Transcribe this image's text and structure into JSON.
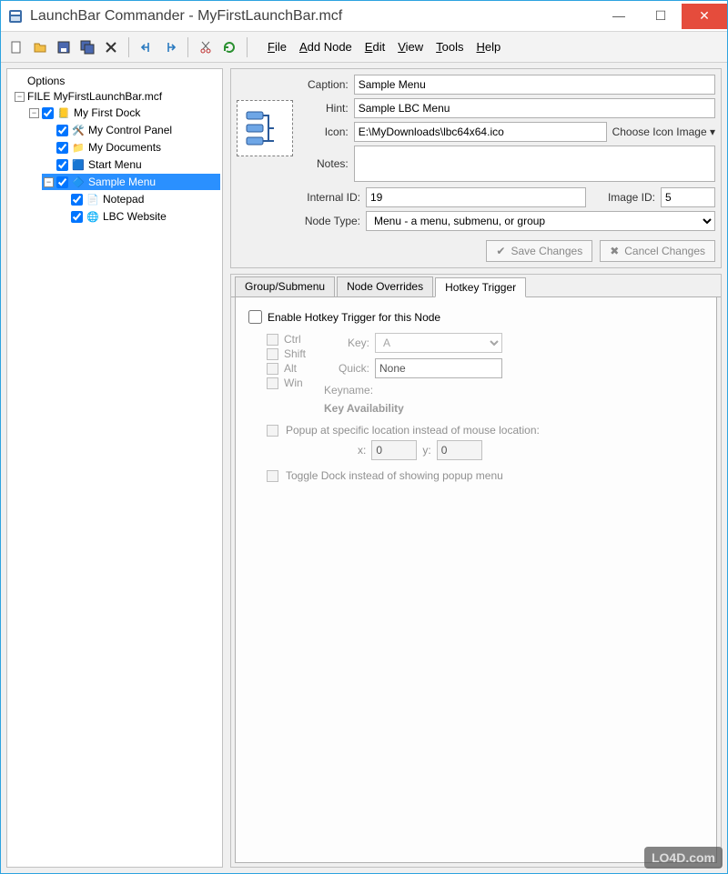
{
  "window": {
    "title": "LaunchBar Commander - MyFirstLaunchBar.mcf"
  },
  "menubar": {
    "file": "File",
    "addnode": "Add Node",
    "edit": "Edit",
    "view": "View",
    "tools": "Tools",
    "help": "Help"
  },
  "tree": {
    "options": "Options",
    "file_node": "FILE MyFirstLaunchBar.mcf",
    "dock": "My First Dock",
    "items": {
      "mcp": "My Control Panel",
      "mydocs": "My Documents",
      "startmenu": "Start Menu",
      "samplemenu": "Sample Menu",
      "notepad": "Notepad",
      "lbcweb": "LBC Website"
    }
  },
  "props": {
    "labels": {
      "caption": "Caption:",
      "hint": "Hint:",
      "icon": "Icon:",
      "notes": "Notes:",
      "internalid": "Internal ID:",
      "imageid": "Image ID:",
      "nodetype": "Node Type:"
    },
    "caption": "Sample Menu",
    "hint": "Sample LBC Menu",
    "icon_path": "E:\\MyDownloads\\lbc64x64.ico",
    "choose_icon": "Choose Icon Image",
    "notes": "",
    "internal_id": "19",
    "image_id": "5",
    "node_type": "Menu - a menu, submenu, or group",
    "save": "Save Changes",
    "cancel": "Cancel Changes"
  },
  "tabs": {
    "group": "Group/Submenu",
    "overrides": "Node Overrides",
    "hotkey": "Hotkey Trigger"
  },
  "hotkey": {
    "enable": "Enable Hotkey Trigger for this Node",
    "mods": {
      "ctrl": "Ctrl",
      "shift": "Shift",
      "alt": "Alt",
      "win": "Win"
    },
    "key_lbl": "Key:",
    "key_val": "A",
    "quick_lbl": "Quick:",
    "quick_val": "None",
    "keyname_lbl": "Keyname:",
    "keyavail": "Key Availability",
    "popup": "Popup at specific location instead of mouse location:",
    "x_lbl": "x:",
    "x_val": "0",
    "y_lbl": "y:",
    "y_val": "0",
    "toggle": "Toggle Dock instead of showing popup menu"
  },
  "watermark": "LO4D.com"
}
